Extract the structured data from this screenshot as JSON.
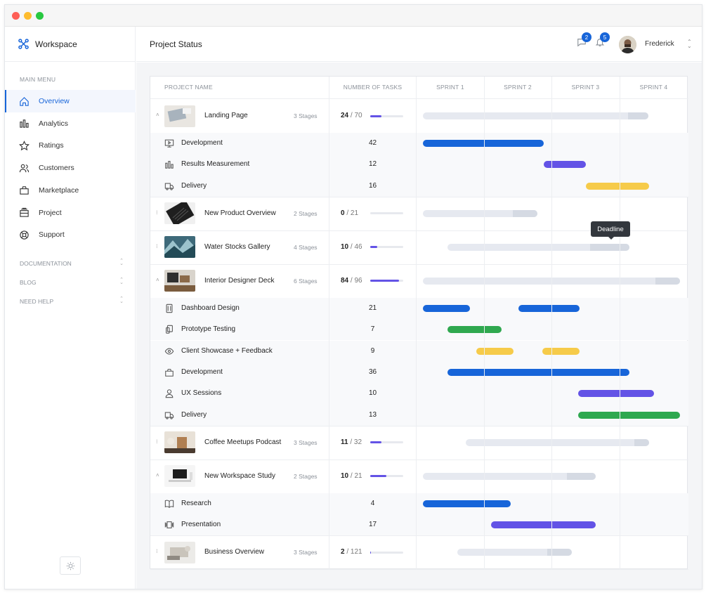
{
  "app": {
    "brand": "Workspace",
    "page_title": "Project Status"
  },
  "header": {
    "messages_badge": "2",
    "notifications_badge": "5",
    "user_name": "Frederick"
  },
  "sidebar": {
    "main_menu_label": "MAIN MENU",
    "items": [
      {
        "label": "Overview",
        "icon": "home-icon",
        "active": true
      },
      {
        "label": "Analytics",
        "icon": "bar-chart-icon"
      },
      {
        "label": "Ratings",
        "icon": "star-icon"
      },
      {
        "label": "Customers",
        "icon": "users-icon"
      },
      {
        "label": "Marketplace",
        "icon": "shopping-bag-icon"
      },
      {
        "label": "Project",
        "icon": "layers-icon"
      },
      {
        "label": "Support",
        "icon": "lifebuoy-icon"
      }
    ],
    "sections": [
      "DOCUMENTATION",
      "BLOG",
      "NEED HELP"
    ]
  },
  "table": {
    "columns": {
      "name": "PROJECT NAME",
      "tasks": "NUMBER OF TASKS",
      "sprints": [
        "SPRINT 1",
        "SPRINT 2",
        "SPRINT 3",
        "SPRINT 4"
      ]
    },
    "tooltip": "Deadline",
    "rows": [
      {
        "kind": "project",
        "name": "Landing Page",
        "stages": "3 Stages",
        "done": "24",
        "total": "/ 70",
        "progress": 0.34,
        "expanded": true,
        "thumb": "laptop-desk"
      },
      {
        "kind": "task",
        "name": "Development",
        "icon": "monitor-icon",
        "count": "42"
      },
      {
        "kind": "task",
        "name": "Results Measurement",
        "icon": "bar-chart-icon",
        "count": "12"
      },
      {
        "kind": "task",
        "name": "Delivery",
        "icon": "truck-icon",
        "count": "16"
      },
      {
        "kind": "project",
        "name": "New Product Overview",
        "stages": "2 Stages",
        "done": "0",
        "total": "/ 21",
        "progress": 0,
        "expanded": false,
        "thumb": "keyboard"
      },
      {
        "kind": "project",
        "name": "Water Stocks Gallery",
        "stages": "4 Stages",
        "done": "10",
        "total": "/ 46",
        "progress": 0.22,
        "expanded": false,
        "thumb": "water"
      },
      {
        "kind": "project",
        "name": "Interior Designer Deck",
        "stages": "6 Stages",
        "done": "84",
        "total": "/ 96",
        "progress": 0.88,
        "expanded": true,
        "thumb": "interior"
      },
      {
        "kind": "task",
        "name": "Dashboard Design",
        "icon": "tablet-icon",
        "count": "21"
      },
      {
        "kind": "task",
        "name": "Prototype Testing",
        "icon": "devices-icon",
        "count": "7"
      },
      {
        "kind": "task",
        "name": "Client Showcase + Feedback",
        "icon": "eye-icon",
        "count": "9"
      },
      {
        "kind": "task",
        "name": "Development",
        "icon": "shopping-bag-icon",
        "count": "36"
      },
      {
        "kind": "task",
        "name": "UX Sessions",
        "icon": "user-icon",
        "count": "10"
      },
      {
        "kind": "task",
        "name": "Delivery",
        "icon": "truck-icon",
        "count": "13"
      },
      {
        "kind": "project",
        "name": "Coffee Meetups Podcast",
        "stages": "3 Stages",
        "done": "11",
        "total": "/ 32",
        "progress": 0.34,
        "expanded": false,
        "thumb": "coffee"
      },
      {
        "kind": "project",
        "name": "New Workspace Study",
        "stages": "2 Stages",
        "done": "10",
        "total": "/ 21",
        "progress": 0.48,
        "expanded": true,
        "thumb": "workspace"
      },
      {
        "kind": "task",
        "name": "Research",
        "icon": "book-icon",
        "count": "4"
      },
      {
        "kind": "task",
        "name": "Presentation",
        "icon": "presentation-icon",
        "count": "17"
      },
      {
        "kind": "project",
        "name": "Business Overview",
        "stages": "3 Stages",
        "done": "2",
        "total": "/ 121",
        "progress": 0.02,
        "expanded": false,
        "thumb": "business"
      }
    ]
  },
  "colors": {
    "accent": "#1765d9",
    "blue": "#1765d9",
    "purple": "#6353e6",
    "yellow": "#f6cb4a",
    "green": "#2fa84f",
    "track": "#e6e9f0",
    "track_end": "#d5dae3"
  }
}
